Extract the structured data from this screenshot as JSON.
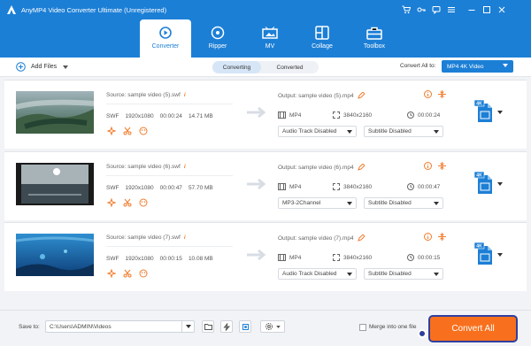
{
  "app": {
    "title": "AnyMP4 Video Converter Ultimate (Unregistered)"
  },
  "nav": {
    "tabs": [
      {
        "label": "Converter",
        "icon": "converter-icon",
        "active": true
      },
      {
        "label": "Ripper",
        "icon": "disc-icon"
      },
      {
        "label": "MV",
        "icon": "mv-icon"
      },
      {
        "label": "Collage",
        "icon": "collage-icon"
      },
      {
        "label": "Toolbox",
        "icon": "toolbox-icon"
      }
    ]
  },
  "toolbar": {
    "add_files": "Add Files",
    "converting": "Converting",
    "converted": "Converted",
    "convert_all_to": "Convert All to:",
    "format": "MP4 4K Video"
  },
  "files": [
    {
      "source": "Source: sample video (5).swf",
      "format": "SWF",
      "resolution": "1920x1080",
      "duration": "00:00:24",
      "size": "14.71 MB",
      "output": "Output: sample video (5).mp4",
      "out_format": "MP4",
      "out_resolution": "3840x2160",
      "out_duration": "00:00:24",
      "audio": "Audio Track Disabled",
      "subtitle": "Subtitle Disabled"
    },
    {
      "source": "Source: sample video (6).swf",
      "format": "SWF",
      "resolution": "1920x1080",
      "duration": "00:00:47",
      "size": "57.70 MB",
      "output": "Output: sample video (6).mp4",
      "out_format": "MP4",
      "out_resolution": "3840x2160",
      "out_duration": "00:00:47",
      "audio": "MP3-2Channel",
      "subtitle": "Subtitle Disabled"
    },
    {
      "source": "Source: sample video (7).swf",
      "format": "SWF",
      "resolution": "1920x1080",
      "duration": "00:00:15",
      "size": "10.08 MB",
      "output": "Output: sample video (7).mp4",
      "out_format": "MP4",
      "out_resolution": "3840x2160",
      "out_duration": "00:00:15",
      "audio": "Audio Track Disabled",
      "subtitle": "Subtitle Disabled"
    }
  ],
  "footer": {
    "save_to": "Save to:",
    "path": "C:\\Users\\ADMIN\\Videos",
    "merge": "Merge into one file",
    "convert_all": "Convert All"
  },
  "colors": {
    "accent": "#1c7fd6",
    "action": "#f8701d",
    "info": "#f27b2b"
  }
}
